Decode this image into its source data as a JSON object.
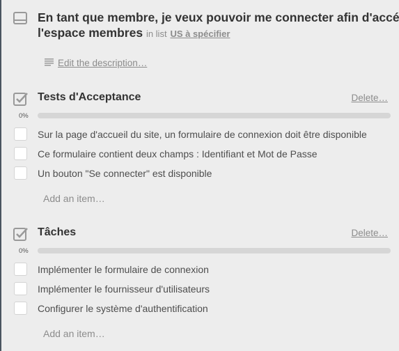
{
  "card": {
    "title_line1": "En tant que membre, je veux pouvoir me connecter afin d'accéder à",
    "title_line2": "l'espace membres",
    "in_list_prefix": "in list",
    "list_name": "US à spécifier",
    "edit_description": "Edit the description…"
  },
  "checklists": [
    {
      "title": "Tests d'Acceptance",
      "delete_label": "Delete…",
      "progress_label": "0%",
      "progress": 0,
      "items": [
        "Sur la page d'accueil du site, un formulaire de connexion doit être disponible",
        "Ce formulaire contient deux champs : Identifiant et Mot de Passe",
        "Un bouton \"Se connecter\" est disponible"
      ],
      "add_item_label": "Add an item…"
    },
    {
      "title": "Tâches",
      "delete_label": "Delete…",
      "progress_label": "0%",
      "progress": 0,
      "items": [
        "Implémenter le formulaire de connexion",
        "Implémenter le fournisseur d'utilisateurs",
        "Configurer le système d'authentification"
      ],
      "add_item_label": "Add an item…"
    }
  ]
}
